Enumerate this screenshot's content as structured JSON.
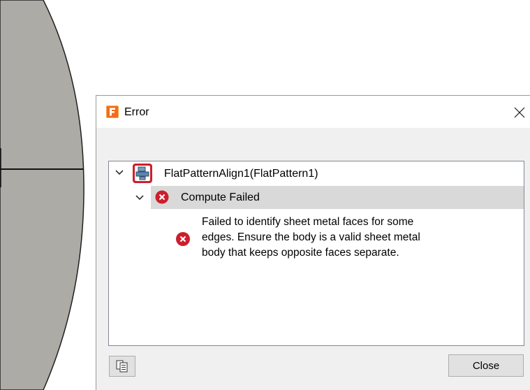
{
  "dialog": {
    "title": "Error",
    "app_icon": "fusion-360-app-icon",
    "close_icon": "close-icon"
  },
  "tree": {
    "feature_node": {
      "label": "FlatPatternAlign1(FlatPattern1)",
      "icon": "flat-pattern-feature-icon",
      "expanded": true
    },
    "status_node": {
      "label": "Compute Failed",
      "icon": "error-icon",
      "expanded": true,
      "selected": true
    },
    "message_node": {
      "lines": [
        "Failed to identify sheet metal faces for some",
        "edges. Ensure the body is a valid sheet metal",
        "body that keeps opposite faces separate."
      ],
      "icon": "error-icon"
    }
  },
  "buttons": {
    "copy_icon": "copy-to-clipboard-icon",
    "close_label": "Close"
  },
  "colors": {
    "error_red": "#cc1f2d",
    "selection_gray": "#d9d9d9",
    "model_body_gray": "#adaba6",
    "app_orange": "#f26b1d"
  }
}
